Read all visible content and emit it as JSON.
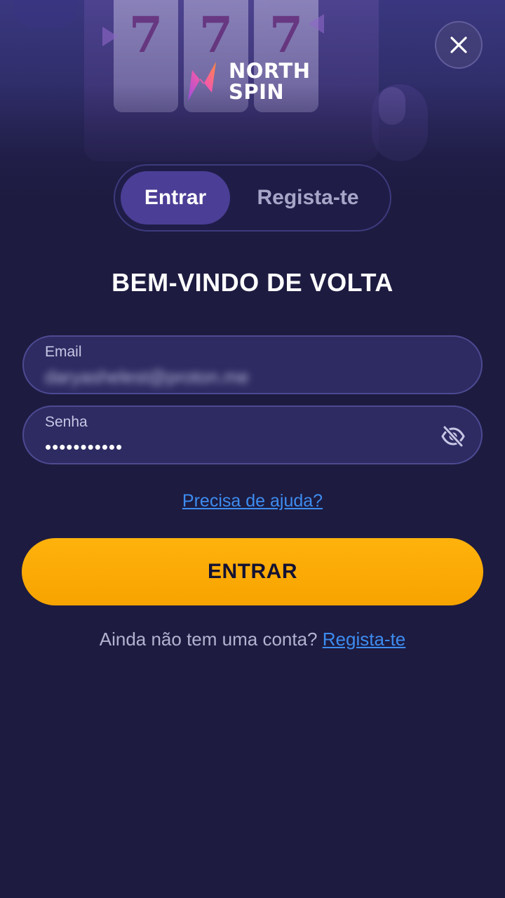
{
  "brand": {
    "line1": "NORTH",
    "line2": "SPIN",
    "mark_colors": [
      "#9b4de0",
      "#f55aa8",
      "#ff8a3d"
    ]
  },
  "close": {
    "icon": "close-icon"
  },
  "hero": {
    "reel_symbols": [
      "7",
      "7",
      "7"
    ]
  },
  "tabs": [
    {
      "label": "Entrar",
      "active": true
    },
    {
      "label": "Regista-te",
      "active": false
    }
  ],
  "heading": "BEM-VINDO DE VOLTA",
  "form": {
    "email": {
      "label": "Email",
      "value": "daryashelest@proton.me"
    },
    "password": {
      "label": "Senha",
      "value": "•••••••••••",
      "toggle_icon": "eye-off-icon"
    }
  },
  "help_link": "Precisa de ajuda?",
  "submit_label": "ENTRAR",
  "signup": {
    "prompt": "Ainda não tem uma conta?",
    "link": "Regista-te"
  },
  "colors": {
    "background": "#1d1b40",
    "accent_button": "#ffb20c",
    "link": "#3d8cf0",
    "active_tab": "#4b3e96"
  }
}
